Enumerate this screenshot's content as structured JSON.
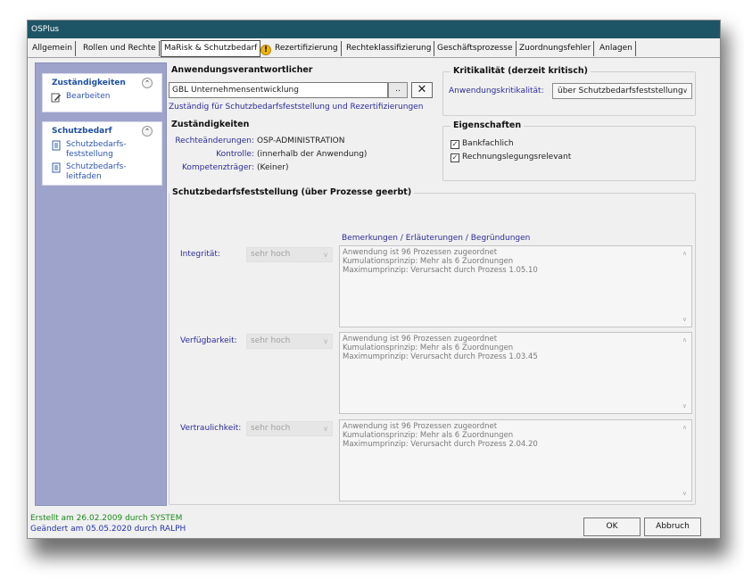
{
  "window": {
    "title": "OSPlus"
  },
  "tabs": [
    "Allgemein",
    "Rollen und Rechte",
    "MaRisk & Schutzbedarf",
    "Rezertifizierung",
    "Rechteklassifizierung",
    "Geschäftsprozesse",
    "Zuordnungsfehler",
    "Anlagen"
  ],
  "sidebar": {
    "zustaendigkeiten": {
      "title": "Zuständigkeiten",
      "items": [
        "Bearbeiten"
      ]
    },
    "schutzbedarf": {
      "title": "Schutzbedarf",
      "items": [
        "Schutzbedarfs- feststellung",
        "Schutzbedarfs- leitfaden"
      ]
    }
  },
  "anwendungsverantwortlicher": {
    "title": "Anwendungsverantwortlicher",
    "value": "GBL Unternehmensentwicklung",
    "browse_label": "..",
    "clear_label": "✕",
    "link": "Zuständig für Schutzbedarfsfeststellung und Rezertifizierungen"
  },
  "kritikalitaet": {
    "title": "Kritikalität (derzeit kritisch)",
    "label": "Anwendungskritikalität:",
    "value": "über Schutzbedarfsfeststellung"
  },
  "zustaendigkeiten": {
    "title": "Zuständigkeiten",
    "rows": [
      {
        "label": "Rechteänderungen:",
        "value": "OSP-ADMINISTRATION"
      },
      {
        "label": "Kontrolle:",
        "value": "(innerhalb der Anwendung)"
      },
      {
        "label": "Kompetenzträger:",
        "value": "(Keiner)"
      }
    ]
  },
  "eigenschaften": {
    "title": "Eigenschaften",
    "checks": [
      {
        "label": "Bankfachlich",
        "checked": true
      },
      {
        "label": "Rechnungslegungsrelevant",
        "checked": true
      }
    ]
  },
  "schutzbedarf": {
    "title": "Schutzbedarfsfeststellung (über Prozesse geerbt)",
    "remarks_header": "Bemerkungen / Erläuterungen / Begründungen",
    "rows": [
      {
        "label": "Integrität:",
        "level": "sehr hoch",
        "remarks": [
          "Anwendung ist 96 Prozessen zugeordnet",
          "Kumulationsprinzip: Mehr als 6 Zuordnungen",
          "Maximumprinzip: Verursacht durch Prozess 1.05.10"
        ]
      },
      {
        "label": "Verfügbarkeit:",
        "level": "sehr hoch",
        "remarks": [
          "Anwendung ist 96 Prozessen zugeordnet",
          "Kumulationsprinzip: Mehr als 6 Zuordnungen",
          "Maximumprinzip: Verursacht durch Prozess 1.03.45"
        ]
      },
      {
        "label": "Vertraulichkeit:",
        "level": "sehr hoch",
        "remarks": [
          "Anwendung ist 96 Prozessen zugeordnet",
          "Kumulationsprinzip: Mehr als 6 Zuordnungen",
          "Maximumprinzip: Verursacht durch Prozess 2.04.20"
        ]
      }
    ]
  },
  "footer": {
    "created": "Erstellt am 26.02.2009 durch SYSTEM",
    "changed": "Geändert am 05.05.2020 durch RALPH",
    "ok": "OK",
    "cancel": "Abbruch"
  }
}
